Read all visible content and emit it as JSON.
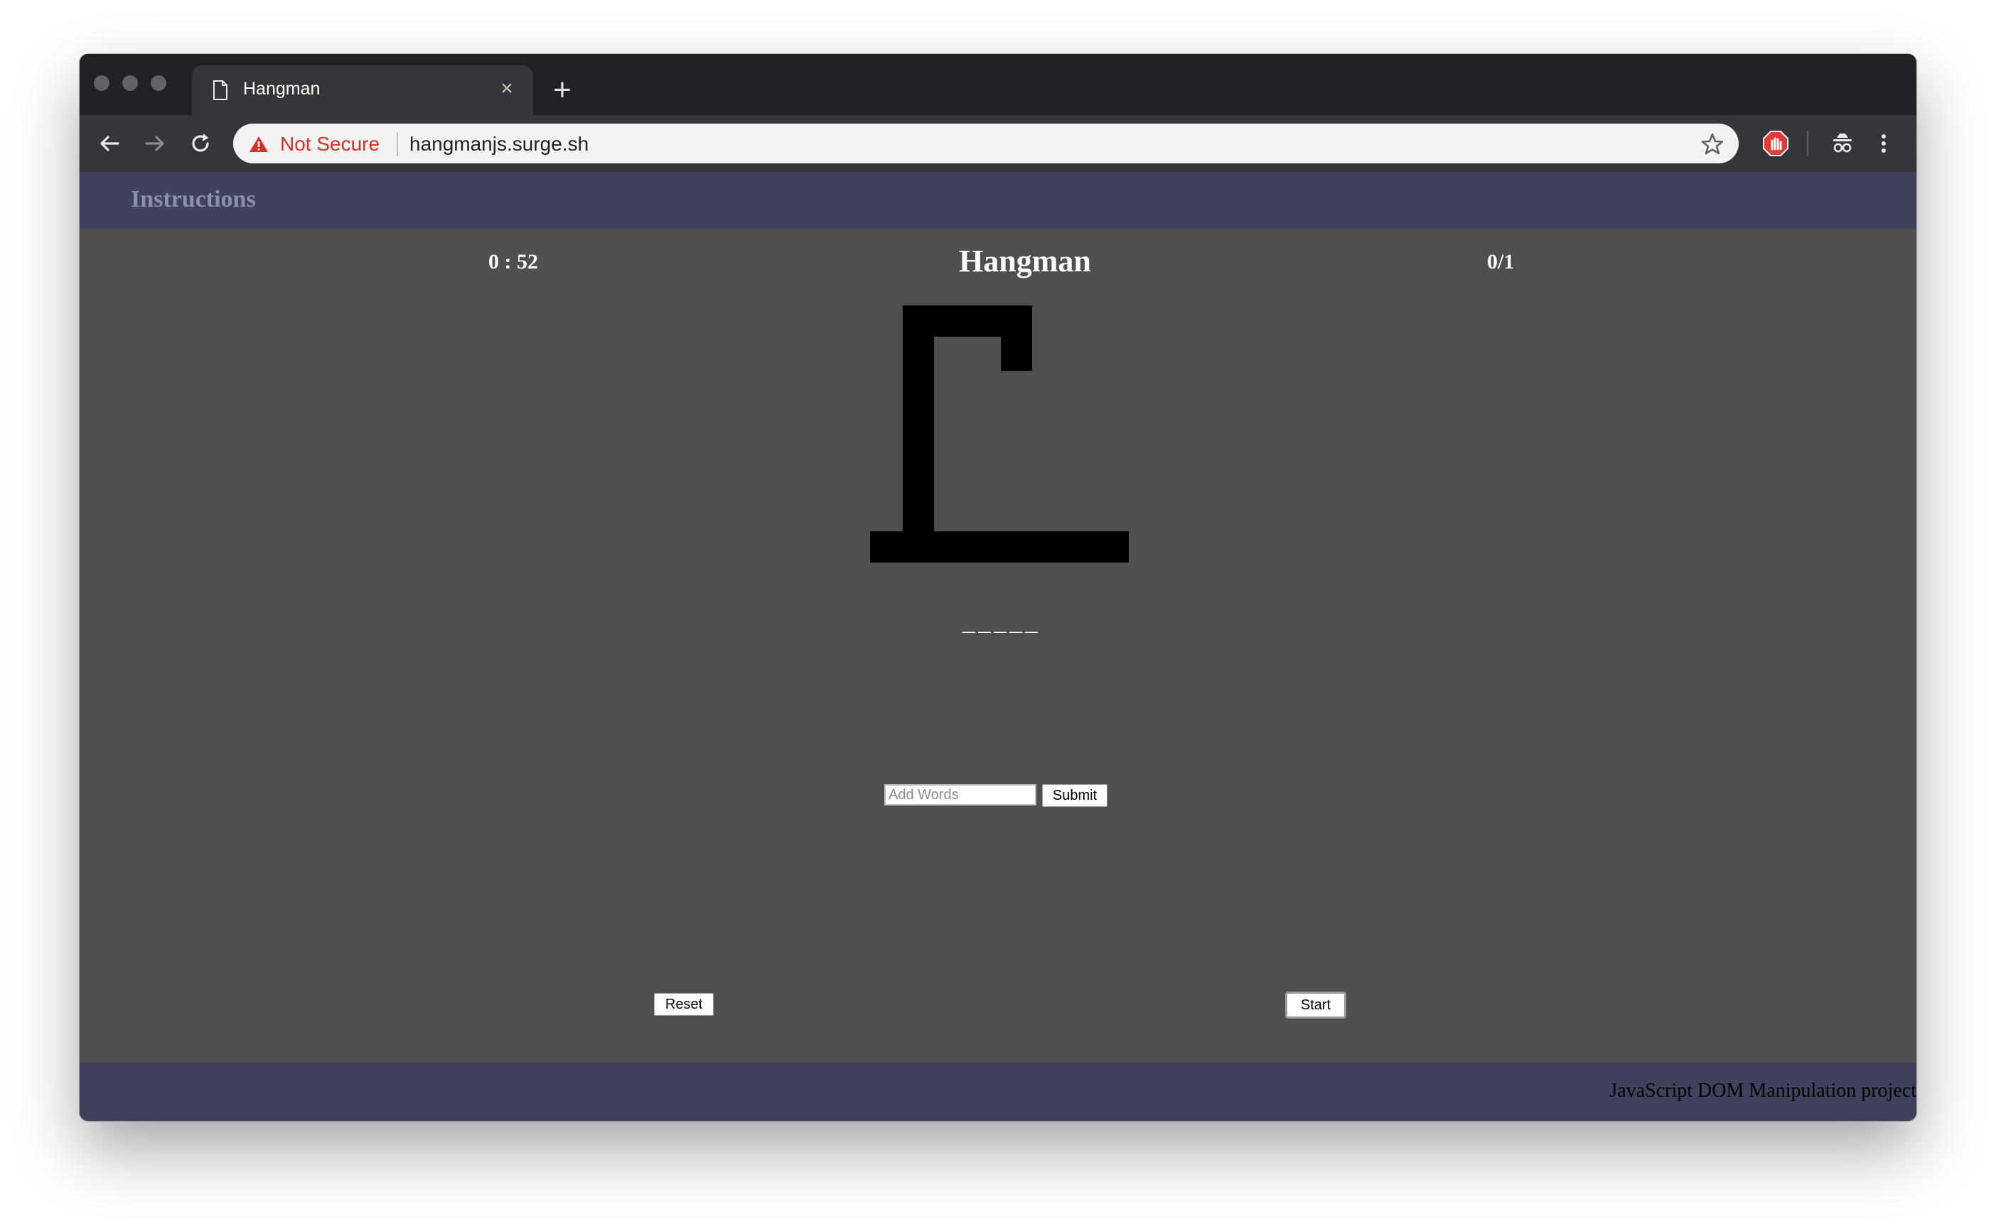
{
  "browser": {
    "tab": {
      "title": "Hangman",
      "close_glyph": "×"
    },
    "new_tab_glyph": "+",
    "security_label": "Not Secure",
    "url": "hangmanjs.surge.sh",
    "icons": [
      "document-icon",
      "back-arrow-icon",
      "forward-arrow-icon",
      "reload-icon",
      "warning-icon",
      "star-icon",
      "adblock-extension-icon",
      "incognito-extension-icon",
      "kebab-menu-icon"
    ],
    "colors": {
      "security_warning": "#d93025",
      "frame": "#202124",
      "toolbar": "#35363a"
    }
  },
  "header": {
    "instructions": "Instructions"
  },
  "game": {
    "timer": "0 : 52",
    "title": "Hangman",
    "score": "0/1",
    "word_blanks": "_____",
    "add_words": {
      "placeholder": "Add Words",
      "submit_label": "Submit"
    },
    "reset_label": "Reset",
    "start_label": "Start"
  },
  "footer": {
    "text": "JavaScript DOM Manipulation project"
  },
  "colors": {
    "page_bg": "#4f4f4f",
    "bar_bg": "#3f415d",
    "gallows": "#000000"
  }
}
